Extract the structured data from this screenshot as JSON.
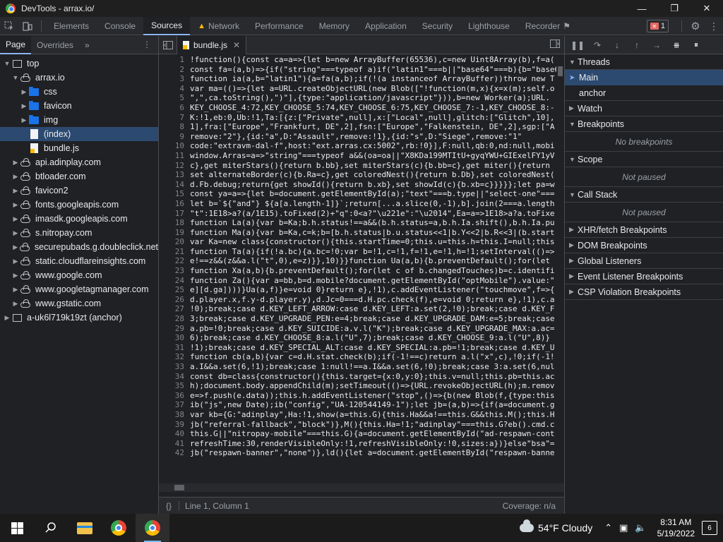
{
  "window": {
    "title": "DevTools - arrax.io/"
  },
  "toolbar": {
    "tabs": [
      {
        "label": "Elements"
      },
      {
        "label": "Console"
      },
      {
        "label": "Sources"
      },
      {
        "label": "Network"
      },
      {
        "label": "Performance"
      },
      {
        "label": "Memory"
      },
      {
        "label": "Application"
      },
      {
        "label": "Security"
      },
      {
        "label": "Lighthouse"
      },
      {
        "label": "Recorder"
      }
    ],
    "error_count": "1"
  },
  "navigator": {
    "tabs": [
      {
        "label": "Page"
      },
      {
        "label": "Overrides"
      }
    ],
    "more": "»",
    "tree": [
      {
        "label": "top"
      },
      {
        "label": "arrax.io"
      },
      {
        "label": "css"
      },
      {
        "label": "favicon"
      },
      {
        "label": "img"
      },
      {
        "label": "(index)"
      },
      {
        "label": "bundle.js"
      },
      {
        "label": "api.adinplay.com"
      },
      {
        "label": "btloader.com"
      },
      {
        "label": "favicon2"
      },
      {
        "label": "fonts.googleapis.com"
      },
      {
        "label": "imasdk.googleapis.com"
      },
      {
        "label": "s.nitropay.com"
      },
      {
        "label": "securepubads.g.doubleclick.net"
      },
      {
        "label": "static.cloudflareinsights.com"
      },
      {
        "label": "www.google.com"
      },
      {
        "label": "www.googletagmanager.com"
      },
      {
        "label": "www.gstatic.com"
      },
      {
        "label": "a-uk6l719k19zt (anchor)"
      }
    ]
  },
  "editor": {
    "file_tab": "bundle.js",
    "lines": [
      {
        "n": "1",
        "t": "!function(){const ca=a=>{let b=new ArrayBuffer(65536),c=new Uint8Array(b),f=a("
      },
      {
        "n": "2",
        "t": "const fa=(a,b)=>{if(\"string\"===typeof a)if(\"latin1\"===b||\"base64\"===b){b=\"base64"
      },
      {
        "n": "3",
        "t": "function ia(a,b=\"latin1\"){a=fa(a,b);if(!(a instanceof ArrayBuffer))throw new T"
      },
      {
        "n": "4",
        "t": "var ma=(()=>{let a=URL.createObjectURL(new Blob([\"!function(m,x){x=x(m);self.o"
      },
      {
        "n": "5",
        "t": "\",\",ca.toString(),\")\"],{type:\"application/javascript\"})),b=new Worker(a);URL."
      },
      {
        "n": "6",
        "t": "KEY_CHOOSE_4:72,KEY_CHOOSE_5:74,KEY_CHOOSE_6:75,KEY_CHOOSE_7:-1,KEY_CHOOSE_8:-"
      },
      {
        "n": "7",
        "t": "K:!1,eb:0,Ub:!1,Ta:[{z:[\"Private\",null],x:[\"Local\",null],glitch:[\"Glitch\",10],"
      },
      {
        "n": "8",
        "t": "1],fra:[\"Europe\",\"Frankfurt, DE\",2],fsn:[\"Europe\",\"Falkenstein, DE\",2],sgp:[\"A"
      },
      {
        "n": "9",
        "t": "remove:\"2\"},{id:\"a\",D:\"Assault\",remove:!1},{id:\"s\",D:\"Siege\",remove:\"1\""
      },
      {
        "n": "10",
        "t": "code:\"extravm-dal-f\",host:\"ext.arras.cx:5002\",rb:!0}],F:null,qb:0,nd:null,mobi"
      },
      {
        "n": "11",
        "t": "window.Arras=a=>\"string\"===typeof a&&(oa=oa||\"X8KDa199MTItU+gyqYWU+GIExelFY1yV"
      },
      {
        "n": "12",
        "t": "c},get miterStars(){return b.bb},set miterStars(c){b.bb=c},get miter(){return"
      },
      {
        "n": "13",
        "t": "set alternateBorder(c){b.Ra=c},get coloredNest(){return b.Db},set coloredNest("
      },
      {
        "n": "14",
        "t": "d.Fb.debug;return{get showId(){return b.xb},set showId(c){b.xb=c}}}}};let pa=w"
      },
      {
        "n": "15",
        "t": "const ya=a=>{let b=document.getElementById(a);\"text\"===b.type||\"select-one\"==="
      },
      {
        "n": "16",
        "t": "let b=`${\"and\"} ${a[a.length-1]}`;return[...a.slice(0,-1),b].join(2===a.length"
      },
      {
        "n": "17",
        "t": "\"t\":1E18>a?(a/1E15).toFixed(2)+\"q\":0<a?\"\\u221e\":\"\\u2014\",Ea=a=>1E18>a?a.toFixe"
      },
      {
        "n": "18",
        "t": "function La(a){var b=Ka;b.h.status!==a&&(b.h.status=a,b.h.Ia.shift(),b.h.Ia.pu"
      },
      {
        "n": "19",
        "t": "function Ma(a){var b=Ka,c=k;b=[b.h.status|b.u.status<<1|b.Y<<2|b.R<<3|(b.start"
      },
      {
        "n": "20",
        "t": "var Ka=new class{constructor(){this.startTime=0;this.u=this.h=this.I=null;this"
      },
      {
        "n": "21",
        "t": "function Ta(a){if(!a.bc){a.bc=!0;var b=!1,c=!1,f=!1,e=!1,h=!1;setInterval(()=>"
      },
      {
        "n": "22",
        "t": "e!==z&&(z&&a.l(\"t\",0),e=z)}},10)}}function Ua(a,b){b.preventDefault();for(let"
      },
      {
        "n": "23",
        "t": "function Xa(a,b){b.preventDefault();for(let c of b.changedTouches)b=c.identifi"
      },
      {
        "n": "24",
        "t": "function Za(){var a=bb,b=d.mobile?document.getElementById(\"optMobile\").value:\""
      },
      {
        "n": "25",
        "t": "e][d.ga])))}Ua(a,f)}e=void 0}return e},!1),c.addEventListener(\"touchmove\",f=>{"
      },
      {
        "n": "26",
        "t": "d.player.x,f.y-d.player.y),d.Jc=0===d.H.pc.check(f),e=void 0;return e},!1),c.a"
      },
      {
        "n": "27",
        "t": "!0);break;case d.KEY_LEFT_ARROW:case d.KEY_LEFT:a.set(2,!0);break;case d.KEY_F"
      },
      {
        "n": "28",
        "t": "3;break;case d.KEY_UPGRADE_PEN:e=4;break;case d.KEY_UPGRADE_DAM:e=5;break;case"
      },
      {
        "n": "29",
        "t": "a.pb=!0;break;case d.KEY_SUICIDE:a.v.l(\"K\");break;case d.KEY_UPGRADE_MAX:a.ac="
      },
      {
        "n": "30",
        "t": "6);break;case d.KEY_CHOOSE_8:a.l(\"U\",7);break;case d.KEY_CHOOSE_9:a.l(\"U\",8)}"
      },
      {
        "n": "31",
        "t": "!1);break;case d.KEY_SPECIAL_ALT:case d.KEY_SPECIAL:a.pb=!1;break;case d.KEY_U"
      },
      {
        "n": "32",
        "t": "function cb(a,b){var c=d.H.stat.check(b);if(-1!==c)return a.l(\"x\",c),!0;if(-1!"
      },
      {
        "n": "33",
        "t": "a.I&&a.set(6,!1);break;case 1:null!==a.I&&a.set(6,!0);break;case 3:a.set(6,nul"
      },
      {
        "n": "34",
        "t": "const db=class{constructor(){this.target={x:0,y:0};this.v=null;this.pb=this.ac"
      },
      {
        "n": "35",
        "t": "h);document.body.appendChild(m);setTimeout(()=>{URL.revokeObjectURL(h);m.remov"
      },
      {
        "n": "36",
        "t": "e=>f.push(e.data));this.h.addEventListener(\"stop\",()=>{b(new Blob(f,{type:this"
      },
      {
        "n": "37",
        "t": "ib(\"js\",new Date);ib(\"config\",\"UA-120544149-1\");let jb=(a,b)=>{if(a=document.g"
      },
      {
        "n": "38",
        "t": "var kb={G:\"adinplay\",Ha:!1,show(a=this.G){this.Ha&&a!==this.G&&this.M();this.H"
      },
      {
        "n": "39",
        "t": "jb(\"referral-fallback\",\"block\")},M(){this.Ha=!1;\"adinplay\"===this.G?eb().cmd.c"
      },
      {
        "n": "40",
        "t": "this.G||\"nitropay-mobile\"===this.G){a=document.getElementById(\"ad-respawn-cont"
      },
      {
        "n": "41",
        "t": "refreshTime:30,renderVisibleOnly:!1,refreshVisibleOnly:!0,sizes:a})}else\"bsa\"="
      },
      {
        "n": "42",
        "t": "jb(\"respawn-banner\",\"none\")},ld(){let a=document.getElementById(\"respawn-banne"
      }
    ],
    "status": {
      "braces": "{}",
      "position": "Line 1, Column 1",
      "coverage": "Coverage: n/a"
    }
  },
  "debugger": {
    "sections": {
      "threads": "Threads",
      "thread_main": "Main",
      "thread_anchor": "anchor",
      "watch": "Watch",
      "breakpoints": "Breakpoints",
      "no_breakpoints": "No breakpoints",
      "scope": "Scope",
      "scope_msg": "Not paused",
      "callstack": "Call Stack",
      "callstack_msg": "Not paused",
      "xhr": "XHR/fetch Breakpoints",
      "dom": "DOM Breakpoints",
      "global": "Global Listeners",
      "event": "Event Listener Breakpoints",
      "csp": "CSP Violation Breakpoints"
    }
  },
  "taskbar": {
    "weather_temp": "54°F",
    "weather_desc": "Cloudy",
    "time": "8:31 AM",
    "date": "5/19/2022",
    "notif_count": "6"
  }
}
